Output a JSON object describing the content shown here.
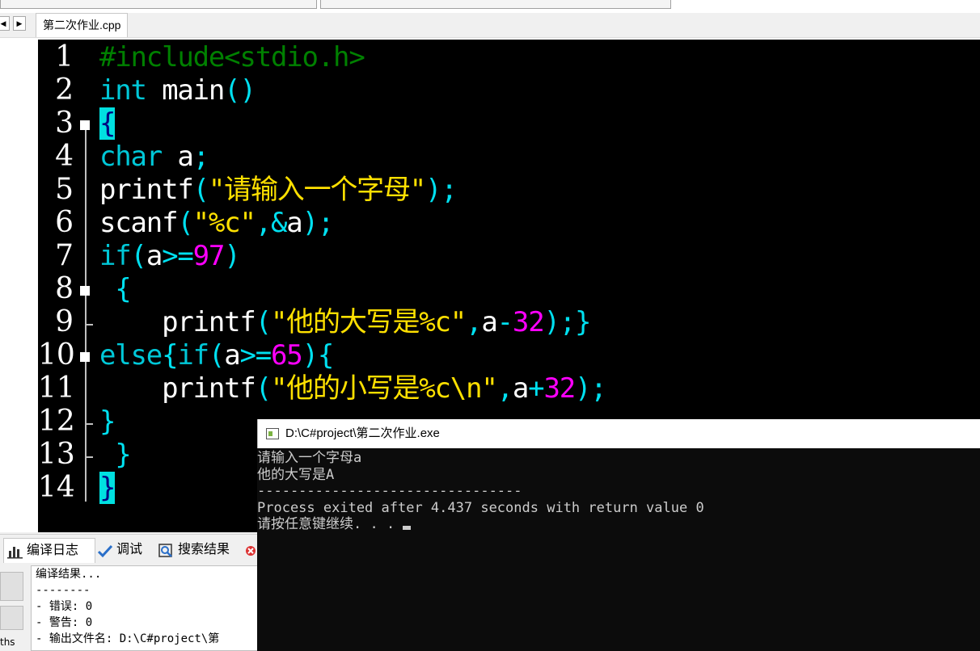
{
  "editor": {
    "tab_label": "第二次作业.cpp",
    "line_numbers": [
      "1",
      "2",
      "3",
      "4",
      "5",
      "6",
      "7",
      "8",
      "9",
      "10",
      "11",
      "12",
      "13",
      "14"
    ],
    "lines": [
      [
        {
          "t": "#include<stdio.h>",
          "c": "c-pre"
        }
      ],
      [
        {
          "t": "int",
          "c": "c-kw"
        },
        {
          "t": " main",
          "c": "c-wh"
        },
        {
          "t": "()",
          "c": "c-cy"
        }
      ],
      [
        {
          "t": "{",
          "c": "brace-hl"
        }
      ],
      [
        {
          "t": "char",
          "c": "c-kw"
        },
        {
          "t": " a",
          "c": "c-wh"
        },
        {
          "t": ";",
          "c": "c-cy"
        }
      ],
      [
        {
          "t": "printf",
          "c": "c-wh"
        },
        {
          "t": "(",
          "c": "c-cy"
        },
        {
          "t": "\"请输入一个字母\"",
          "c": "c-str"
        },
        {
          "t": ");",
          "c": "c-cy"
        }
      ],
      [
        {
          "t": "scanf",
          "c": "c-wh"
        },
        {
          "t": "(",
          "c": "c-cy"
        },
        {
          "t": "\"%c\"",
          "c": "c-str"
        },
        {
          "t": ",&",
          "c": "c-cy"
        },
        {
          "t": "a",
          "c": "c-wh"
        },
        {
          "t": ");",
          "c": "c-cy"
        }
      ],
      [
        {
          "t": "if",
          "c": "c-kw"
        },
        {
          "t": "(",
          "c": "c-cy"
        },
        {
          "t": "a",
          "c": "c-wh"
        },
        {
          "t": ">=",
          "c": "c-cy"
        },
        {
          "t": "97",
          "c": "c-num"
        },
        {
          "t": ")",
          "c": "c-cy"
        }
      ],
      [
        {
          "t": " {",
          "c": "c-cy"
        }
      ],
      [
        {
          "t": "    printf",
          "c": "c-wh"
        },
        {
          "t": "(",
          "c": "c-cy"
        },
        {
          "t": "\"他的大写是%c\"",
          "c": "c-str"
        },
        {
          "t": ",",
          "c": "c-cy"
        },
        {
          "t": "a",
          "c": "c-wh"
        },
        {
          "t": "-",
          "c": "c-cy"
        },
        {
          "t": "32",
          "c": "c-num"
        },
        {
          "t": ");}",
          "c": "c-cy"
        }
      ],
      [
        {
          "t": "else",
          "c": "c-kw"
        },
        {
          "t": "{",
          "c": "c-cy"
        },
        {
          "t": "if",
          "c": "c-kw"
        },
        {
          "t": "(",
          "c": "c-cy"
        },
        {
          "t": "a",
          "c": "c-wh"
        },
        {
          "t": ">=",
          "c": "c-cy"
        },
        {
          "t": "65",
          "c": "c-num"
        },
        {
          "t": "){",
          "c": "c-cy"
        }
      ],
      [
        {
          "t": "    printf",
          "c": "c-wh"
        },
        {
          "t": "(",
          "c": "c-cy"
        },
        {
          "t": "\"他的小写是%c\\n\"",
          "c": "c-str"
        },
        {
          "t": ",",
          "c": "c-cy"
        },
        {
          "t": "a",
          "c": "c-wh"
        },
        {
          "t": "+",
          "c": "c-cy"
        },
        {
          "t": "32",
          "c": "c-num"
        },
        {
          "t": ");",
          "c": "c-cy"
        }
      ],
      [
        {
          "t": "}",
          "c": "c-cy"
        }
      ],
      [
        {
          "t": " }",
          "c": "c-cy"
        }
      ],
      [
        {
          "t": "}",
          "c": "brace-hl"
        }
      ]
    ]
  },
  "bottom_tabs": [
    {
      "label": "编译日志",
      "icon": "bar-chart-icon",
      "active": true
    },
    {
      "label": "调试",
      "icon": "check-icon",
      "active": false
    },
    {
      "label": "搜索结果",
      "icon": "search-icon",
      "active": false
    }
  ],
  "compile_log": [
    "编译结果...",
    "--------",
    "- 错误: 0",
    "- 警告: 0",
    "- 输出文件名: D:\\C#project\\第"
  ],
  "side_text": "ths",
  "console": {
    "title": "D:\\C#project\\第二次作业.exe",
    "output": [
      "请输入一个字母a",
      "他的大写是A",
      "--------------------------------",
      "Process exited after 4.437 seconds with return value 0",
      "请按任意键继续. . . "
    ]
  },
  "colors": {
    "editor_bg": "#000000",
    "keyword": "#00c8d8",
    "string": "#ffe000",
    "number": "#ff00ff",
    "preprocessor": "#008000",
    "brace_highlight": "#00e0e0"
  }
}
